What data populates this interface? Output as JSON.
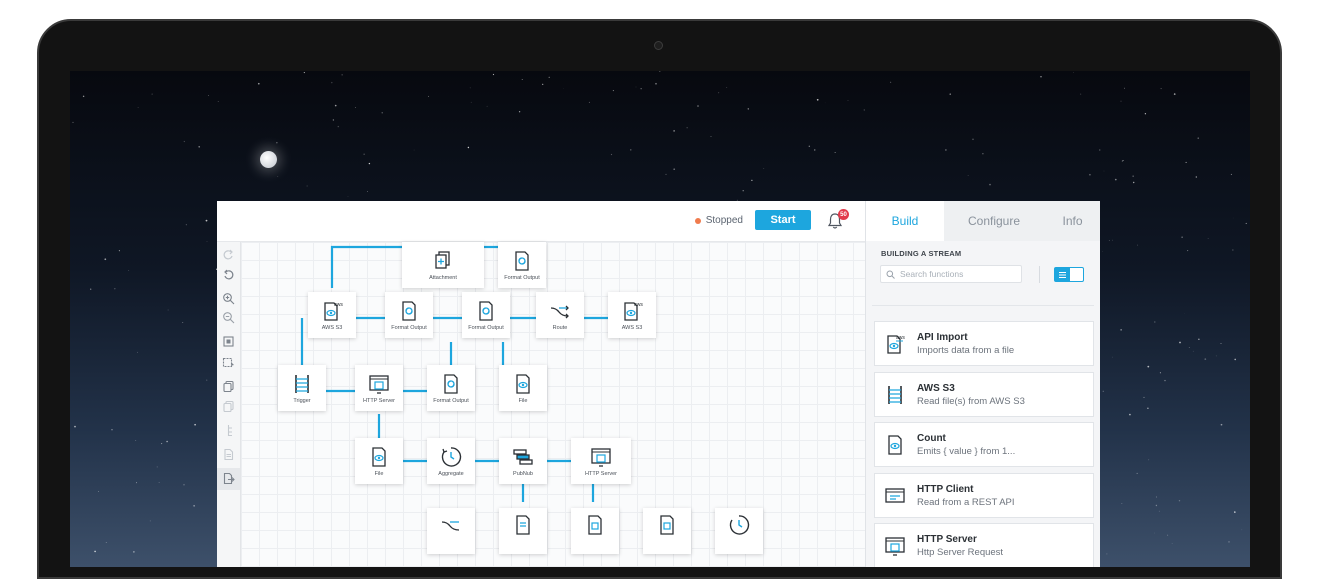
{
  "toolbar_top": {
    "status_text": "Stopped",
    "start_label": "Start",
    "notification_count": "50"
  },
  "canvas": {
    "nodes": {
      "attachment": "Attachment",
      "format_output_1": "Format Output",
      "aws_s3_1": "AWS S3",
      "format_output_2": "Format Output",
      "format_output_3": "Format Output",
      "route": "Route",
      "aws_s3_2": "AWS S3",
      "trigger": "Trigger",
      "http_server_1": "HTTP Server",
      "format_output_4": "Format Output",
      "file_1": "File",
      "file_2": "File",
      "aggregate": "Aggregate",
      "pubnub": "PubNub",
      "http_server_2": "HTTP Server"
    }
  },
  "panel": {
    "tabs": [
      "Build",
      "Configure",
      "Info"
    ],
    "heading": "BUILDING A STREAM",
    "search_placeholder": "Search functions",
    "functions": [
      {
        "title": "API Import",
        "desc": "Imports data from a file",
        "icon": "aws-file-icon"
      },
      {
        "title": "AWS S3",
        "desc": "Read file(s) from AWS S3",
        "icon": "dna-icon"
      },
      {
        "title": "Count",
        "desc": "Emits { value } from 1...",
        "icon": "file-eye-icon"
      },
      {
        "title": "HTTP Client",
        "desc": "Read from a REST API",
        "icon": "browser-icon"
      },
      {
        "title": "HTTP Server",
        "desc": "Http Server Request",
        "icon": "server-icon"
      }
    ]
  },
  "colors": {
    "accent": "#1da6de",
    "status_stopped": "#f07b4d",
    "badge": "#e23a4b"
  }
}
